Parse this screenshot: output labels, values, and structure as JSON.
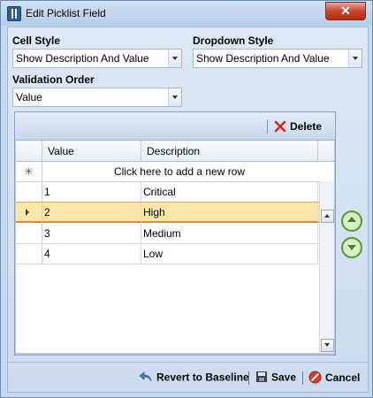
{
  "window": {
    "title": "Edit Picklist Field",
    "close_label": "✕"
  },
  "cell_style": {
    "label": "Cell Style",
    "value": "Show Description And Value"
  },
  "dropdown_style": {
    "label": "Dropdown Style",
    "value": "Show Description And Value"
  },
  "validation_order": {
    "label": "Validation Order",
    "value": "Value"
  },
  "toolbar": {
    "delete_label": "Delete"
  },
  "grid": {
    "columns": [
      "Value",
      "Description"
    ],
    "new_row_marker": "✳",
    "new_row_text": "Click here to add a new row",
    "rows": [
      {
        "value": "1",
        "description": "Critical"
      },
      {
        "value": "2",
        "description": "High"
      },
      {
        "value": "3",
        "description": "Medium"
      },
      {
        "value": "4",
        "description": "Low"
      }
    ]
  },
  "footer": {
    "revert_label": "Revert to Baseline",
    "save_label": "Save",
    "cancel_label": "Cancel"
  },
  "colors": {
    "accent_green": "#3b8a1c",
    "selected_row": "#fbe7ac",
    "close_red": "#c8452f"
  }
}
